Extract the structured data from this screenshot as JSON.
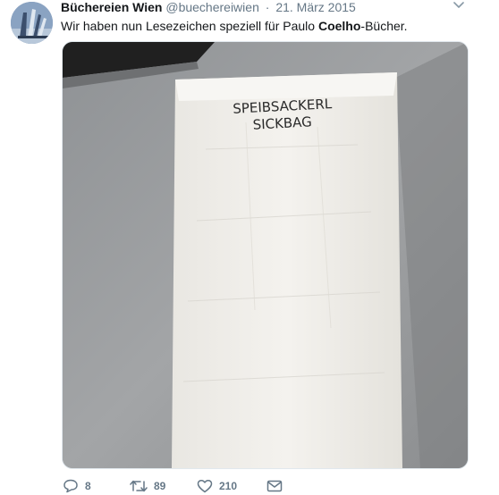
{
  "tweet": {
    "display_name": "Büchereien Wien",
    "handle": "@buechereiwien",
    "separator": "·",
    "date": "21. März 2015",
    "text_before": "Wir haben nun Lesezeichen speziell für Paulo ",
    "text_bold": "Coelho",
    "text_after": "-Bücher."
  },
  "media": {
    "bag_print_line1": "SPEIBSACKERL",
    "bag_print_line2": "SICKBAG"
  },
  "actions": {
    "reply_count": "8",
    "retweet_count": "89",
    "like_count": "210"
  },
  "icons": {
    "avatar": "library-building-icon",
    "caret": "chevron-down-icon",
    "reply": "reply-icon",
    "retweet": "retweet-icon",
    "like": "heart-icon",
    "dm": "envelope-icon"
  },
  "colors": {
    "text": "#14171a",
    "secondary": "#657786",
    "border": "#e1e8ed"
  }
}
